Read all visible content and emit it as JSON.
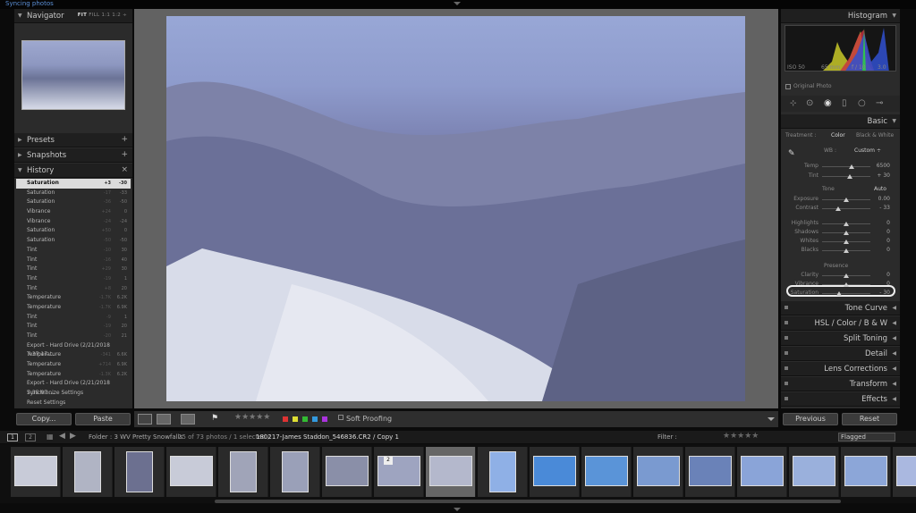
{
  "status_text": "Syncing photos",
  "left": {
    "navigator": {
      "title": "Navigator",
      "fit": "FIT",
      "fill": "FILL",
      "z1": "1:1",
      "z2": "1:2"
    },
    "presets": "Presets",
    "snapshots": "Snapshots",
    "history": "History",
    "history_items": [
      {
        "label": "Saturation",
        "v1": "+3",
        "v2": "-30"
      },
      {
        "label": "Saturation",
        "v1": "-17",
        "v2": "-33"
      },
      {
        "label": "Saturation",
        "v1": "-36",
        "v2": "-50"
      },
      {
        "label": "Vibrance",
        "v1": "+24",
        "v2": "0"
      },
      {
        "label": "Vibrance",
        "v1": "-24",
        "v2": "-24"
      },
      {
        "label": "Saturation",
        "v1": "+50",
        "v2": "0"
      },
      {
        "label": "Saturation",
        "v1": "-50",
        "v2": "-50"
      },
      {
        "label": "Tint",
        "v1": "-10",
        "v2": "30"
      },
      {
        "label": "Tint",
        "v1": "-16",
        "v2": "40"
      },
      {
        "label": "Tint",
        "v1": "+29",
        "v2": "30"
      },
      {
        "label": "Tint",
        "v1": "-19",
        "v2": "1"
      },
      {
        "label": "Tint",
        "v1": "+8",
        "v2": "20"
      },
      {
        "label": "Temperature",
        "v1": "-1.7K",
        "v2": "6.2K"
      },
      {
        "label": "Temperature",
        "v1": "-1.7K",
        "v2": "6.9K"
      },
      {
        "label": "Tint",
        "v1": "-9",
        "v2": "1"
      },
      {
        "label": "Tint",
        "v1": "-19",
        "v2": "20"
      },
      {
        "label": "Tint",
        "v1": "-20",
        "v2": "21"
      },
      {
        "label": "Export - Hard Drive (2/21/2018 7:37:17 ...",
        "v1": "",
        "v2": ""
      },
      {
        "label": "Temperature",
        "v1": "-341",
        "v2": "6.6K"
      },
      {
        "label": "Temperature",
        "v1": "+714",
        "v2": "6.9K"
      },
      {
        "label": "Temperature",
        "v1": "-1.3K",
        "v2": "6.2K"
      },
      {
        "label": "Export - Hard Drive (2/21/2018 7:35:07 ...",
        "v1": "",
        "v2": ""
      },
      {
        "label": "Synchronize Settings",
        "v1": "",
        "v2": ""
      },
      {
        "label": "Reset Settings",
        "v1": "",
        "v2": ""
      }
    ],
    "copy_label": "Copy...",
    "paste_label": "Paste"
  },
  "toolbar": {
    "soft_proofing": "Soft Proofing",
    "flag_colors": [
      "#d33",
      "#dd3",
      "#3b3",
      "#39d",
      "#a3d"
    ]
  },
  "right": {
    "histogram": "Histogram",
    "iso": "ISO 50",
    "focal": "65 mm",
    "aperture": "f / 10",
    "shutter": "3.0 sec",
    "original_photo": "Original Photo",
    "basic": "Basic",
    "treatment": "Treatment :",
    "color": "Color",
    "bw": "Black & White",
    "wb": "WB :",
    "wb_value": "Custom ÷",
    "sliders": [
      {
        "label": "Temp",
        "value": "6500",
        "pos": 0.62
      },
      {
        "label": "Tint",
        "value": "+ 30",
        "pos": 0.58
      }
    ],
    "tone": "Tone",
    "auto": "Auto",
    "tone_sliders": [
      {
        "label": "Exposure",
        "value": "0.00",
        "pos": 0.5
      },
      {
        "label": "Contrast",
        "value": "- 33",
        "pos": 0.33
      }
    ],
    "tone_sliders2": [
      {
        "label": "Highlights",
        "value": "0",
        "pos": 0.5
      },
      {
        "label": "Shadows",
        "value": "0",
        "pos": 0.5
      },
      {
        "label": "Whites",
        "value": "0",
        "pos": 0.5
      },
      {
        "label": "Blacks",
        "value": "0",
        "pos": 0.5
      }
    ],
    "presence": "Presence",
    "presence_sliders": [
      {
        "label": "Clarity",
        "value": "0",
        "pos": 0.5
      },
      {
        "label": "Vibrance",
        "value": "0",
        "pos": 0.5
      },
      {
        "label": "Saturation",
        "value": "- 30",
        "pos": 0.35
      }
    ],
    "sections": [
      "Tone Curve",
      "HSL / Color / B & W",
      "Split Toning",
      "Detail",
      "Lens Corrections",
      "Transform",
      "Effects"
    ],
    "previous": "Previous",
    "reset": "Reset"
  },
  "filmstrip": {
    "pages": [
      "1",
      "2"
    ],
    "folder": "Folder : 3 WV Pretty Snowfalls",
    "count": "25 of 73 photos / 1 selected / ",
    "file": "180217-James Staddon_546836.CR2 / Copy 1",
    "filter": "Filter :",
    "flagged": "Flagged",
    "stack_badge": "2"
  }
}
